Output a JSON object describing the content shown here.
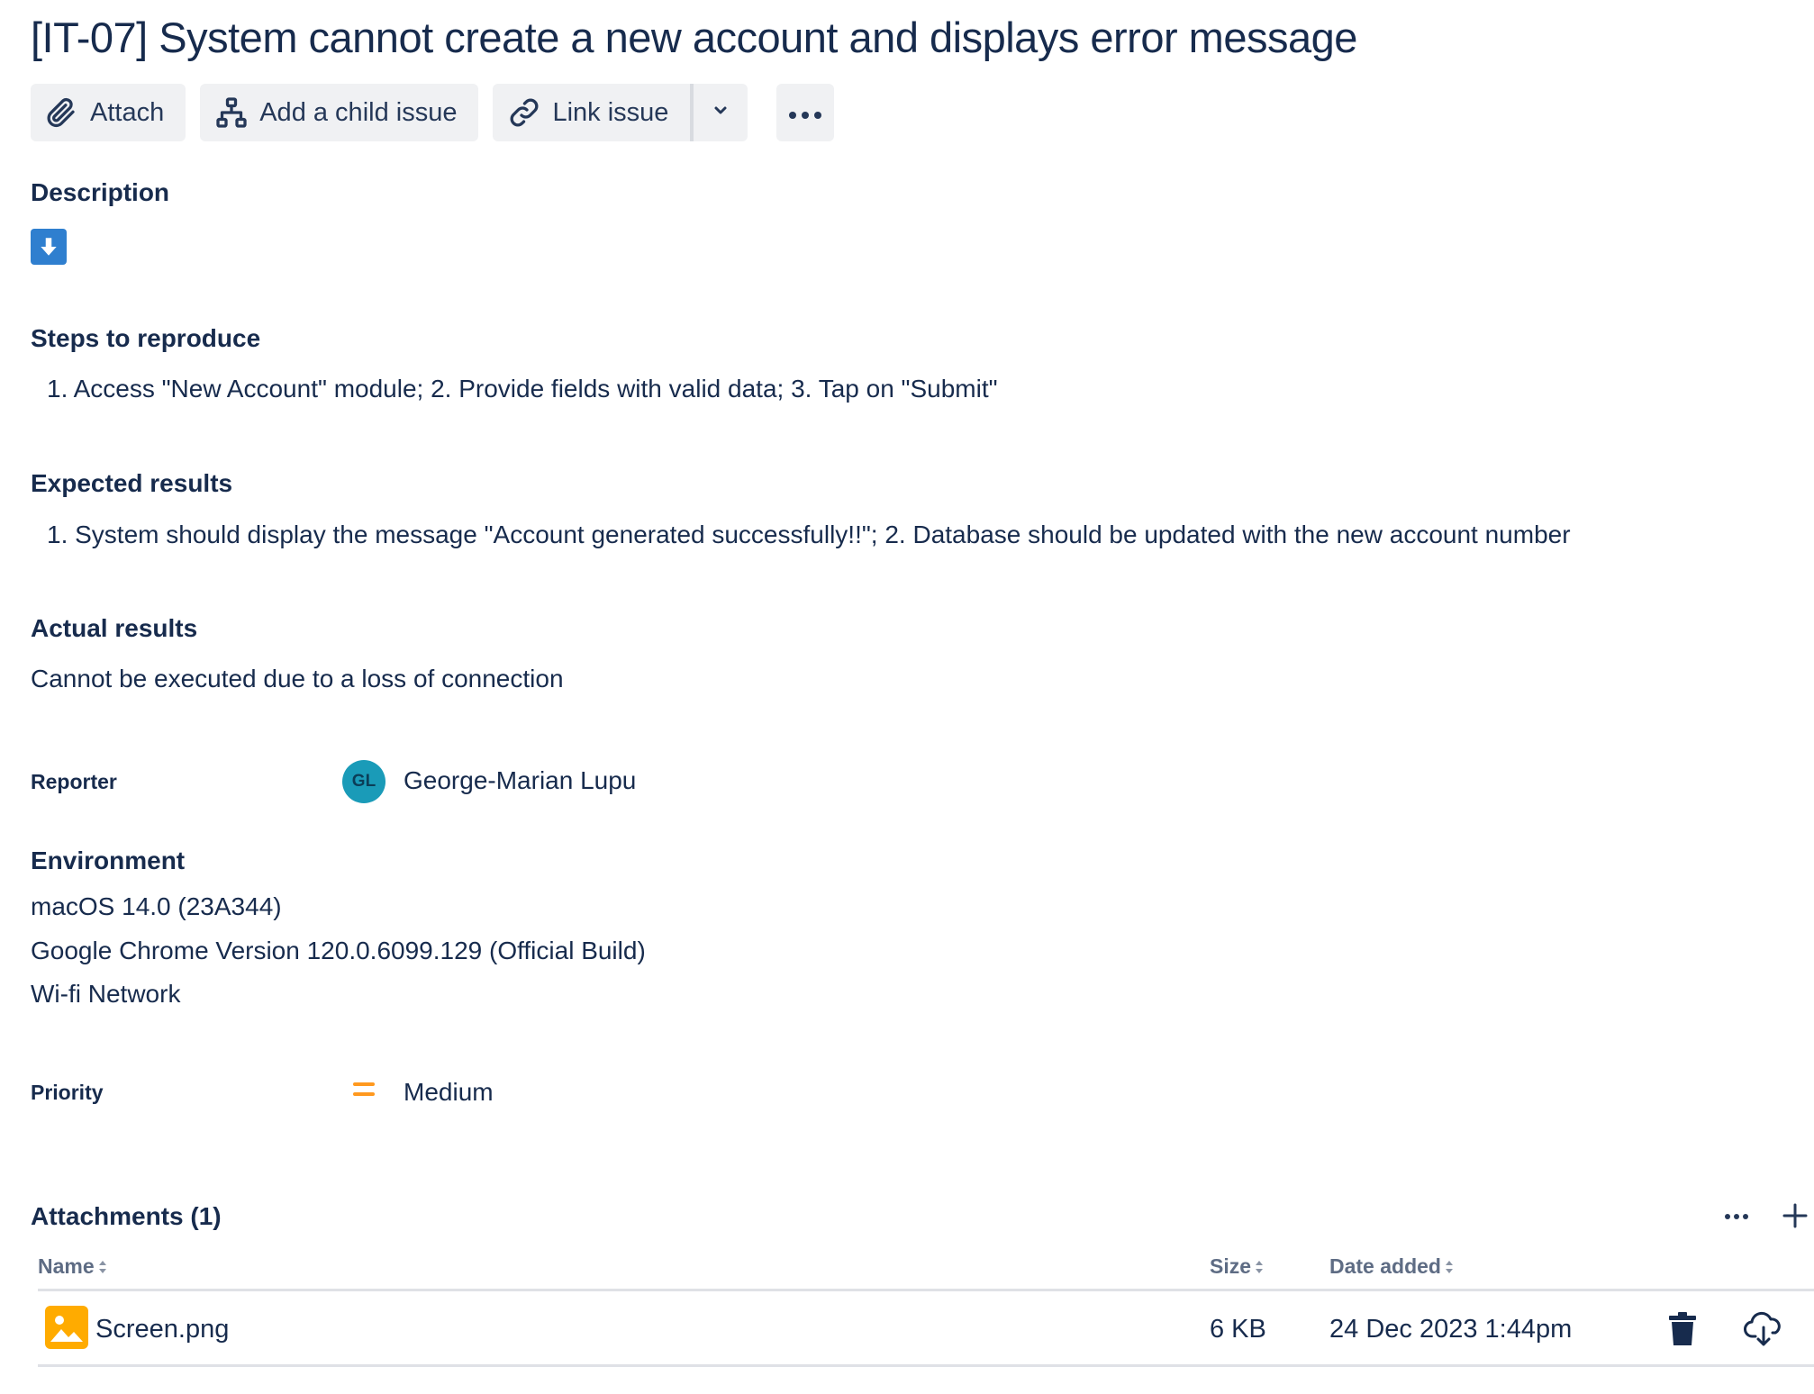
{
  "issue": {
    "title": "[IT-07] System cannot create a new account and displays error message"
  },
  "toolbar": {
    "attach_label": "Attach",
    "child_issue_label": "Add a child issue",
    "link_issue_label": "Link issue"
  },
  "description": {
    "heading": "Description",
    "steps_heading": "Steps to reproduce",
    "steps_text": "1. Access \"New Account\" module; 2. Provide fields with valid data; 3. Tap on \"Submit\"",
    "expected_heading": "Expected results",
    "expected_text": "1. System should display the message \"Account generated successfully!!\"; 2. Database should be updated with the new account number",
    "actual_heading": "Actual results",
    "actual_text": "Cannot be executed due to a loss of connection"
  },
  "reporter": {
    "label": "Reporter",
    "initials": "GL",
    "name": "George-Marian Lupu",
    "avatar_color": "#1a9bb8"
  },
  "environment": {
    "heading": "Environment",
    "lines": [
      "macOS 14.0 (23A344)",
      "Google Chrome Version 120.0.6099.129 (Official Build)",
      "Wi-fi Network"
    ]
  },
  "priority": {
    "label": "Priority",
    "value": "Medium",
    "icon": "priority-medium-icon",
    "color": "#ff991f"
  },
  "attachments": {
    "heading": "Attachments (1)",
    "columns": {
      "name": "Name",
      "size": "Size",
      "date": "Date added"
    },
    "rows": [
      {
        "name": "Screen.png",
        "size": "6 KB",
        "date": "24 Dec 2023 1:44pm"
      }
    ]
  },
  "colors": {
    "text": "#172b4d",
    "button_bg": "#f0f1f3",
    "description_icon": "#2f7fcf",
    "file_icon": "#ffab00"
  }
}
